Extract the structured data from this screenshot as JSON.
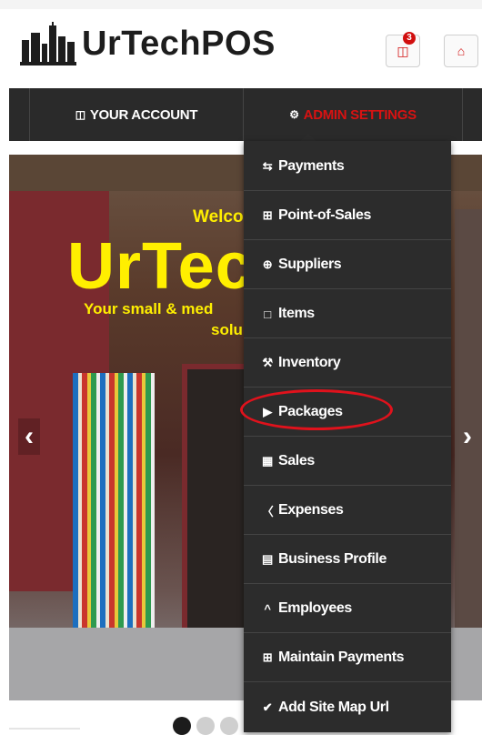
{
  "header": {
    "brand": "UrTechPOS",
    "notification_count": "3"
  },
  "nav": {
    "your_account": "YOUR ACCOUNT",
    "admin_settings": "ADMIN SETTINGS"
  },
  "hero": {
    "welcome": "Welco",
    "brand": "UrTec",
    "tagline_1": "Your small & med",
    "tagline_2": "solu",
    "prev": "‹",
    "next": "›"
  },
  "dropdown": {
    "items": [
      {
        "label": "Payments",
        "icon": "exchange-icon"
      },
      {
        "label": "Point-of-Sales",
        "icon": "grid-icon"
      },
      {
        "label": "Suppliers",
        "icon": "plus-circle-icon"
      },
      {
        "label": "Items",
        "icon": "tag-icon"
      },
      {
        "label": "Inventory",
        "icon": "wrench-icon"
      },
      {
        "label": "Packages",
        "icon": "play-circle-icon"
      },
      {
        "label": "Sales",
        "icon": "book-icon"
      },
      {
        "label": "Expenses",
        "icon": "cart-icon"
      },
      {
        "label": "Business Profile",
        "icon": "clipboard-icon"
      },
      {
        "label": "Employees",
        "icon": "chevron-up-icon"
      },
      {
        "label": "Maintain Payments",
        "icon": "grid-icon"
      },
      {
        "label": "Add Site Map Url",
        "icon": "check-circle-icon"
      }
    ]
  },
  "colors": {
    "accent": "#d81212",
    "nav_bg": "#2a2a2a",
    "dropdown_bg": "#2c2c2c",
    "hero_text": "#ffef00"
  }
}
